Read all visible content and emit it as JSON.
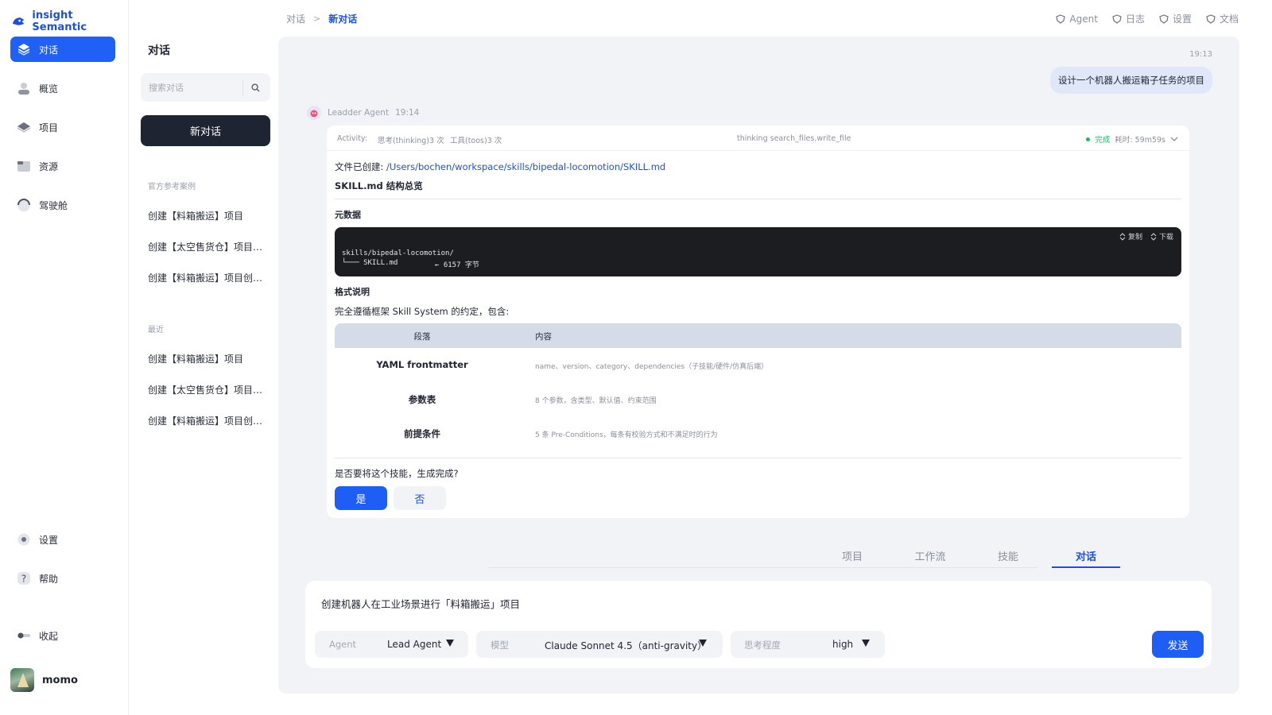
{
  "brand": {
    "name": "insight Semantic"
  },
  "nav": {
    "items": [
      {
        "label": "对话",
        "icon": "chat-icon",
        "active": true
      },
      {
        "label": "概览",
        "icon": "overview-icon"
      },
      {
        "label": "项目",
        "icon": "project-icon"
      },
      {
        "label": "资源",
        "icon": "folder-icon"
      },
      {
        "label": "驾驶舱",
        "icon": "dashboard-icon"
      }
    ],
    "bottom": [
      {
        "label": "设置",
        "icon": "gear-icon"
      },
      {
        "label": "帮助",
        "icon": "help-icon"
      },
      {
        "label": "收起",
        "icon": "collapse-icon"
      }
    ],
    "user": {
      "name": "momo"
    }
  },
  "list": {
    "title": "对话",
    "search_placeholder": "搜索对话",
    "new_label": "新对话",
    "official_label": "官方参考案例",
    "official": [
      "创建【料箱搬运】项目",
      "创建【太空售货仓】项目…",
      "创建【料箱搬运】项目创…"
    ],
    "recent_label": "最近",
    "recent": [
      "创建【料箱搬运】项目",
      "创建【太空售货仓】项目…",
      "创建【料箱搬运】项目创…"
    ]
  },
  "breadcrumb": {
    "root": "对话",
    "sep": ">",
    "current": "新对话"
  },
  "topnav": [
    "Agent",
    "日志",
    "设置",
    "文档"
  ],
  "chat": {
    "user_time": "19:13",
    "user_message": "设计一个机器人搬运箱子任务的项目",
    "agent_name": "Leadder Agent",
    "agent_time": "19:14",
    "activity": {
      "label": "Activity:",
      "thinking": "思考(thinking)3 次",
      "tools": "工具(toos)3 次",
      "tool_names": "thinking search_files,write_file",
      "status": "完成",
      "elapsed": "耗时: 59m59s"
    },
    "file_created_label": "文件已创建:",
    "file_path": "/Users/bochen/workspace/skills/bipedal-locomotion/SKILL.md",
    "structure_title": "SKILL.md 结构总览",
    "meta_title": "元数据",
    "code": {
      "copy_label": "复制",
      "download_label": "下载",
      "line1": "skills/bipedal-locomotion/",
      "line2": "└─── SKILL.md",
      "line2_note": "← 6157 字节"
    },
    "format_title": "格式说明",
    "format_desc": "完全遵循框架 Skill System 的约定，包含:",
    "table": {
      "headers": [
        "段落",
        "内容"
      ],
      "rows": [
        [
          "YAML frontmatter",
          "name、version、category、dependencies（子技能/硬件/仿真后端）"
        ],
        [
          "参数表",
          "8 个参数，含类型、默认值、约束范围"
        ],
        [
          "前提条件",
          "5 条 Pre-Conditions，每条有校验方式和不满足时的行为"
        ]
      ]
    },
    "question": "是否要将这个技能，生成完成?",
    "yes": "是",
    "no": "否"
  },
  "tabs": [
    "项目",
    "工作流",
    "技能",
    "对话"
  ],
  "active_tab": "对话",
  "composer": {
    "text": "创建机器人在工业场景进行「料箱搬运」项目",
    "agent_label": "Agent",
    "agent_value": "Lead Agent",
    "model_label": "模型",
    "model_value": "Claude Sonnet 4.5（anti-gravity）",
    "effort_label": "思考程度",
    "effort_value": "high",
    "send": "发送"
  },
  "colors": {
    "accent": "#1f5ef5",
    "dark_button": "#1f2433",
    "panel_bg": "#f1f3f7",
    "success": "#1fb86a"
  }
}
